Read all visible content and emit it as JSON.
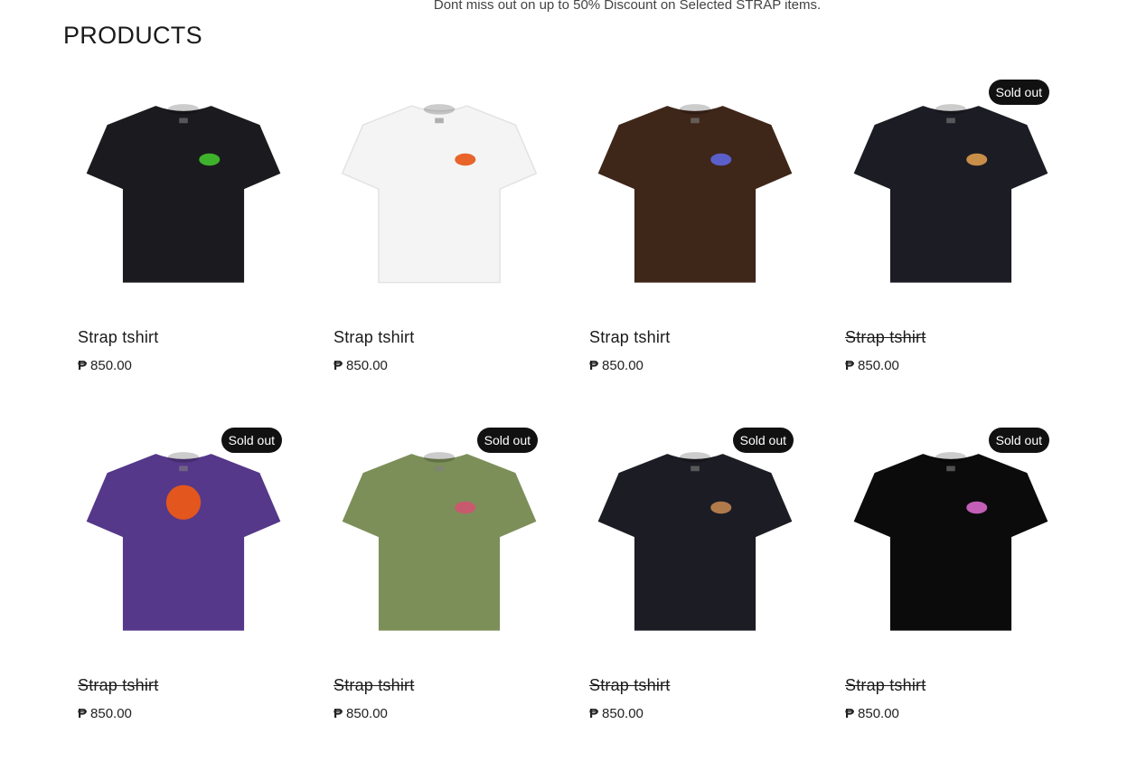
{
  "banner": "Dont miss out on up to 50% Discount on Selected STRAP items.",
  "section_title": "PRODUCTS",
  "products": [
    {
      "name": "Strap tshirt",
      "currency": "₱",
      "price": "850.00",
      "sold_out": false,
      "badge": "",
      "shirt_color": "#1b1b1f",
      "logo_color": "#3fb22c"
    },
    {
      "name": "Strap tshirt",
      "currency": "₱",
      "price": "850.00",
      "sold_out": false,
      "badge": "",
      "shirt_color": "#f4f4f4",
      "logo_color": "#e8642a"
    },
    {
      "name": "Strap tshirt",
      "currency": "₱",
      "price": "850.00",
      "sold_out": false,
      "badge": "",
      "shirt_color": "#3e2619",
      "logo_color": "#5b5fc9"
    },
    {
      "name": "Strap tshirt",
      "currency": "₱",
      "price": "850.00",
      "sold_out": true,
      "badge": "Sold out",
      "shirt_color": "#1c1c24",
      "logo_color": "#c98e48"
    },
    {
      "name": "Strap tshirt",
      "currency": "₱",
      "price": "850.00",
      "sold_out": true,
      "badge": "Sold out",
      "shirt_color": "#553889",
      "logo_color": "#e3561e"
    },
    {
      "name": "Strap tshirt",
      "currency": "₱",
      "price": "850.00",
      "sold_out": true,
      "badge": "Sold out",
      "shirt_color": "#7c8f59",
      "logo_color": "#c85a6e"
    },
    {
      "name": "Strap tshirt",
      "currency": "₱",
      "price": "850.00",
      "sold_out": true,
      "badge": "Sold out",
      "shirt_color": "#1c1c24",
      "logo_color": "#b07a4a"
    },
    {
      "name": "Strap tshirt",
      "currency": "₱",
      "price": "850.00",
      "sold_out": true,
      "badge": "Sold out",
      "shirt_color": "#0b0b0b",
      "logo_color": "#c35fb6"
    }
  ]
}
